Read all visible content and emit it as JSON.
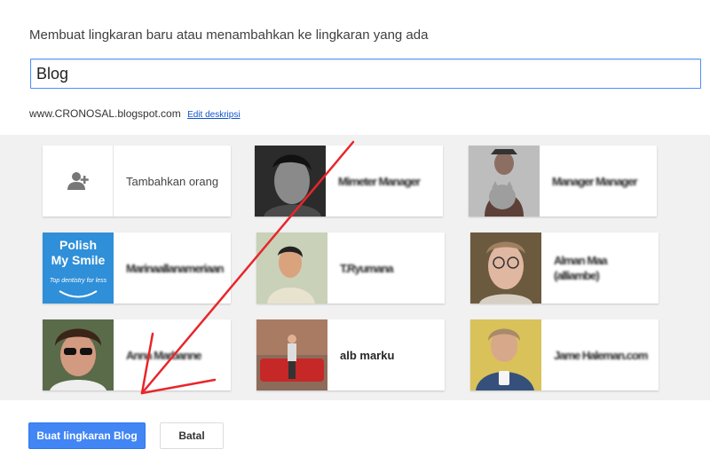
{
  "dialog": {
    "heading": "Membuat lingkaran baru atau menambahkan ke lingkaran yang ada",
    "circle_name_value": "Blog",
    "description": "www.CRONOSAL.blogspot.com",
    "edit_description_link": "Edit deskripsi"
  },
  "people": [
    {
      "name": "Tambahkan orang",
      "type": "add"
    },
    {
      "name": "Mimeter Manager",
      "obscured": true
    },
    {
      "name": "Manager Manager",
      "obscured": true
    },
    {
      "name": "Marinaallanameriaan",
      "obscured": true,
      "avatar_text": [
        "Polish",
        "My Smile",
        "Top dentistry for less"
      ]
    },
    {
      "name": "T.Ryumana",
      "obscured": true
    },
    {
      "name": "Alman Maa (alliambe)",
      "obscured": true
    },
    {
      "name": "Anna Marbanne",
      "obscured": true
    },
    {
      "name": "alb marku",
      "obscured": false
    },
    {
      "name": "Jame Haleman.com",
      "obscured": true
    }
  ],
  "buttons": {
    "create": "Buat lingkaran Blog",
    "cancel": "Batal"
  },
  "colors": {
    "accent": "#4285f4",
    "annotation_arrow": "#e8262b"
  }
}
